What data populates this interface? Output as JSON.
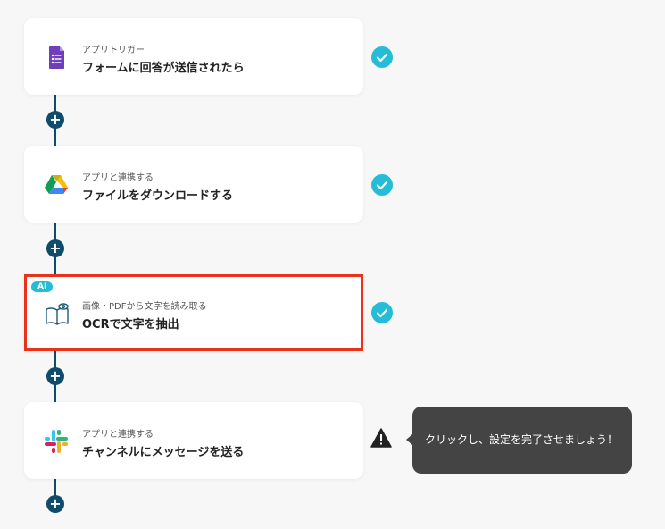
{
  "steps": [
    {
      "subtitle": "アプリトリガー",
      "title": "フォームに回答が送信されたら",
      "icon": "google-forms-icon",
      "status": "complete"
    },
    {
      "subtitle": "アプリと連携する",
      "title": "ファイルをダウンロードする",
      "icon": "google-drive-icon",
      "status": "complete"
    },
    {
      "subtitle": "画像・PDFから文字を読み取る",
      "title": "OCRで文字を抽出",
      "icon": "ocr-book-icon",
      "status": "complete",
      "badge": "AI",
      "selected": true
    },
    {
      "subtitle": "アプリと連携する",
      "title": "チャンネルにメッセージを送る",
      "icon": "slack-icon",
      "status": "warning"
    }
  ],
  "add_button_label": "+",
  "tooltip": {
    "text": "クリックし、設定を完了させましょう！"
  },
  "colors": {
    "accent": "#25bcd6",
    "connector": "#0f4c6b",
    "highlight": "#e8321a",
    "tooltip_bg": "#444444"
  }
}
